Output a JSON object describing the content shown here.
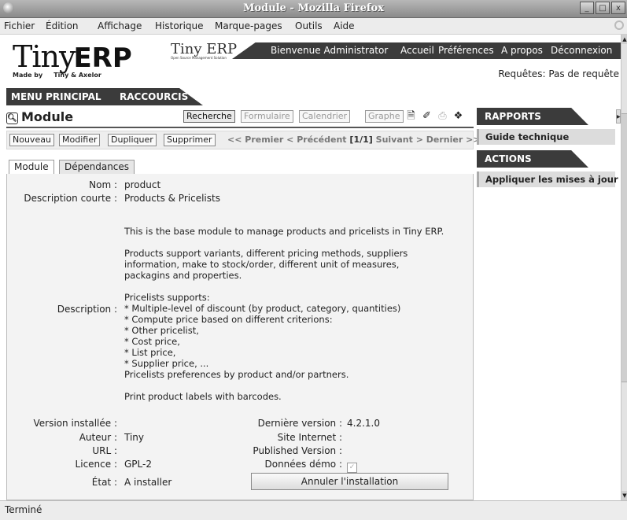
{
  "window": {
    "title": "Module - Mozilla Firefox",
    "controls": [
      "_",
      "□",
      "x"
    ]
  },
  "menu": [
    "Fichier",
    "Édition",
    "Affichage",
    "Historique",
    "Marque-pages",
    "Outils",
    "Aide"
  ],
  "header": {
    "logo_main": "Tiny",
    "logo_erp": "ERP",
    "logo_madeby": "Made by",
    "logo_company": "Tiny & Axelor",
    "mini_logo": "Tiny ERP",
    "mini_logo_sub": "Open Source Management Solution",
    "welcome": "Bienvenue Administrator",
    "links": [
      "Accueil",
      "Préférences",
      "A propos",
      "Déconnexion"
    ],
    "requests_label": "Requêtes:",
    "requests_value": "Pas de requête"
  },
  "nav": [
    "MENU PRINCIPAL",
    "RACCOURCIS"
  ],
  "view": {
    "title": "Module",
    "modes": [
      "Recherche",
      "Formulaire",
      "Calendrier",
      "Graphe"
    ],
    "active_mode": "Recherche"
  },
  "actions": [
    "Nouveau",
    "Modifier",
    "Dupliquer",
    "Supprimer"
  ],
  "pager": {
    "first": "<< Premier",
    "prev": "< Précédent",
    "count": "[1/1]",
    "next": "Suivant >",
    "last": "Dernier >>"
  },
  "tabs": [
    "Module",
    "Dépendances"
  ],
  "form": {
    "nom_label": "Nom :",
    "nom": "product",
    "short_desc_label": "Description courte :",
    "short_desc": "Products & Pricelists",
    "desc_label": "Description :",
    "description": "This is the base module to manage products and pricelists in Tiny ERP.\n\nProducts support variants, different pricing methods, suppliers\ninformation, make to stock/order, different unit of measures,\npackagins and properties.\n\nPricelists supports:\n* Multiple-level of discount (by product, category, quantities)\n* Compute price based on different criterions:\n* Other pricelist,\n* Cost price,\n* List price,\n* Supplier price, ...\nPricelists preferences by product and/or partners.\n\nPrint product labels with barcodes.",
    "installed_version_label": "Version installée :",
    "installed_version": "",
    "latest_version_label": "Dernière version :",
    "latest_version": "4.2.1.0",
    "author_label": "Auteur :",
    "author": "Tiny",
    "website_label": "Site Internet :",
    "website": "",
    "url_label": "URL :",
    "url": "",
    "published_label": "Published Version :",
    "published": "",
    "license_label": "Licence :",
    "license": "GPL-2",
    "demo_label": "Données démo :",
    "demo_checked": true,
    "state_label": "État :",
    "state": "A installer",
    "cancel_button": "Annuler l'installation"
  },
  "sidebar": {
    "reports_title": "RAPPORTS",
    "reports": [
      "Guide technique"
    ],
    "actions_title": "ACTIONS",
    "actions": [
      "Appliquer les mises à jour"
    ]
  },
  "status": "Terminé"
}
